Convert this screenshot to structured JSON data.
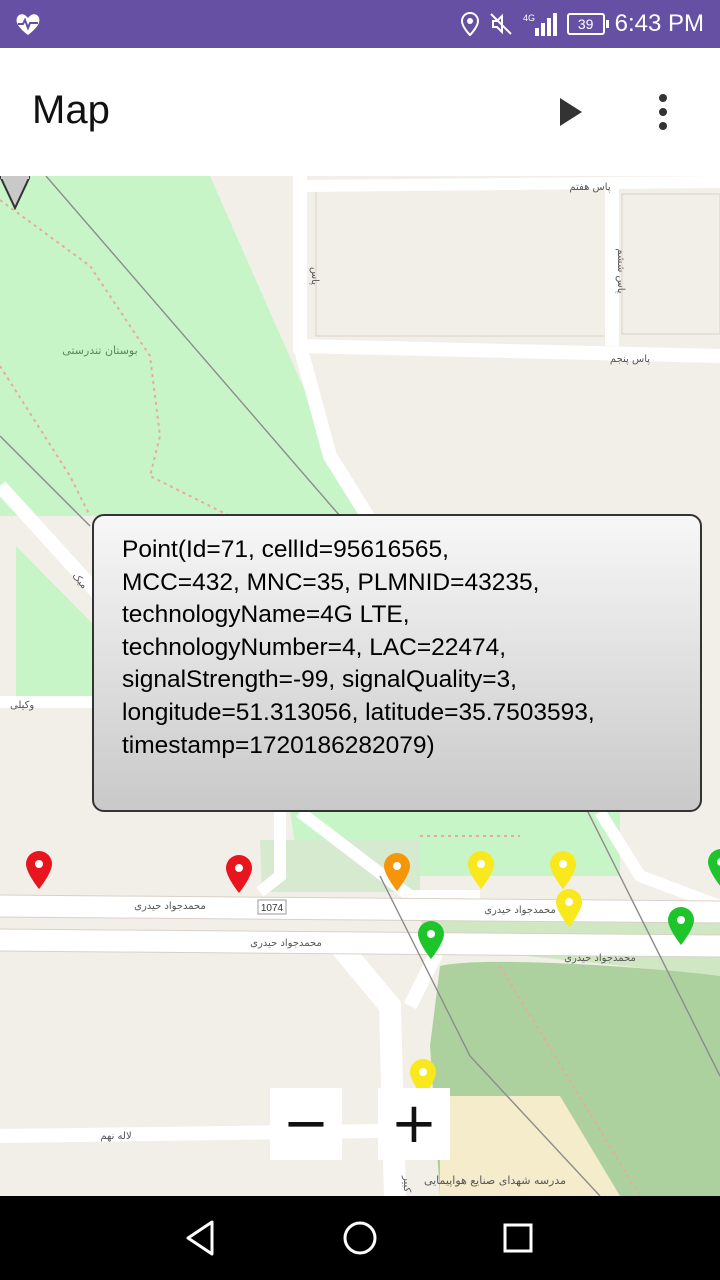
{
  "status_bar": {
    "time": "6:43 PM",
    "battery": "39",
    "network": "4G",
    "icons": [
      "heart-pulse-icon",
      "location-icon",
      "mute-icon",
      "signal-icon",
      "battery-icon"
    ]
  },
  "app_bar": {
    "title": "Map",
    "actions": [
      "play-icon",
      "more-vert-icon"
    ]
  },
  "map": {
    "popup_text": "Point(Id=71, cellId=95616565,\nMCC=432, MNC=35, PLMNID=43235,\ntechnologyName=4G LTE,\ntechnologyNumber=4, LAC=22474,\nsignalStrength=-99, signalQuality=3,\nlongitude=51.313056, latitude=35.7503593,\ntimestamp=1720186282079)",
    "labels": {
      "street_7": "پاس هفتم",
      "street_pas": "پاس",
      "street_6": "پاس ششم",
      "street_5": "پاس پنجم",
      "park": "بوستان تندرستی",
      "street_main_1": "محمدجواد حیدری",
      "street_main_2": "محمدجواد حیدری",
      "street_main_3": "محمدجواد حیدری",
      "street_main_4": "محمدجواد حیدری",
      "road_number": "1074",
      "street_laleh": "لاله نهم",
      "school": "مدرسه شهدای صنایع هواپیمایی",
      "street_vakil": "وکیلی",
      "street_meek": "میک",
      "street_shahid": "شهید کبیر"
    },
    "colors": {
      "red": "#e8141e",
      "orange": "#f5960a",
      "yellow": "#f8e81c",
      "green": "#1ec52a",
      "park": "#c8f5c8",
      "forest": "#add19e",
      "land": "#f2efe9",
      "road": "#ffffff"
    },
    "zoom_out_label": "−",
    "zoom_in_label": "+"
  },
  "nav_bar": {
    "icons": [
      "back-icon",
      "home-icon",
      "recents-icon"
    ]
  }
}
